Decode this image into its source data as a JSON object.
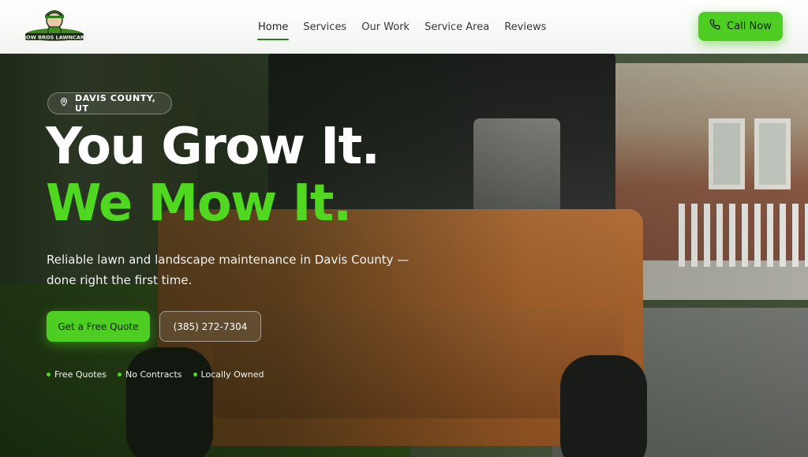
{
  "colors": {
    "accent": "#4ece22",
    "headline_accent": "#4fd81f",
    "header_bg": "#ffffff",
    "text_dark": "#1d241d"
  },
  "header": {
    "logo_alt": "Mow Bros Lawn Care",
    "nav": [
      {
        "label": "Home",
        "active": true
      },
      {
        "label": "Services"
      },
      {
        "label": "Our Work"
      },
      {
        "label": "Service Area"
      },
      {
        "label": "Reviews"
      }
    ],
    "call_button": {
      "label": "Call Now",
      "icon": "phone-icon"
    }
  },
  "hero": {
    "location_badge": {
      "icon": "map-pin-icon",
      "text": "DAVIS COUNTY, UT"
    },
    "headline_line1": "You Grow It.",
    "headline_line2": "We Mow It.",
    "lead": "Reliable lawn and landscape maintenance in Davis County — done right the first time.",
    "primary_button": "Get a Free Quote",
    "secondary_button": "(385) 272-7304",
    "features": [
      "Free Quotes",
      "No Contracts",
      "Locally Owned"
    ]
  }
}
